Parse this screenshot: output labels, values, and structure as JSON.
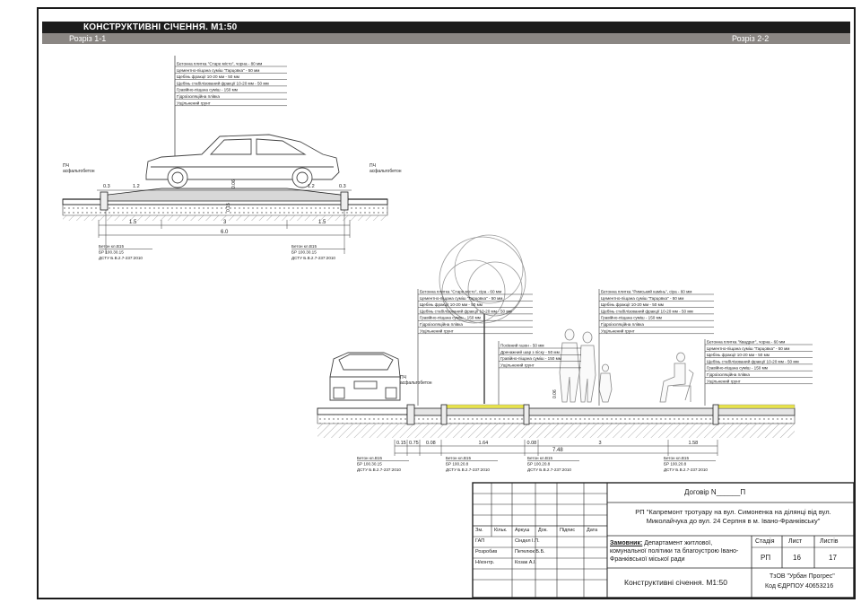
{
  "title": "КОНСТРУКТИВНІ СІЧЕННЯ. М1:50",
  "section1": {
    "label": "Розріз 1-1",
    "layers": [
      "Бетонна плитка \"Старе місто\", чорна - 80 мм",
      "Цементно-піщана суміш \"Гарцовка\" - 50 мм",
      "Щебінь фракції 10-20 мм - 50 мм",
      "Щебінь стабілізований фракції 10-20 мм - 50 мм",
      "Гравійно-піщана суміш - 150 мм",
      "Гідроізоляційна плівка",
      "Ущільнений грунт"
    ],
    "asphalt_left": "ПЧ\nасфальтобетон",
    "asphalt_right": "ПЧ\nасфальтобетон",
    "dims_top": [
      "0.3",
      "1.2",
      "1.2",
      "0.3"
    ],
    "dims_bottom": [
      "1.5",
      "3",
      "1.5"
    ],
    "dim_total": "6.0",
    "vertical_dims": [
      "0.06",
      "0.15"
    ],
    "curb_left": [
      "Бетон кл.В15",
      "БР 100.30.15",
      "ДСТУ Б.В.2.7-237:2010"
    ],
    "curb_right": [
      "Бетон кл.В15",
      "БР 100.30.15",
      "ДСТУ Б.В.2.7-237:2010"
    ]
  },
  "section2": {
    "label": "Розріз 2-2",
    "layers_a": [
      "Бетонна плитка \"Старе місто\", сіра - 60 мм",
      "Цементно-піщана суміш \"Гарцовка\" - 50 мм",
      "Щебінь фракції 10-20 мм - 50 мм",
      "Щебінь стабілізований фракції 10-20 мм - 50 мм",
      "Гравійно-піщана суміш - 150 мм",
      "Гідроізоляційна плівка",
      "Ущільнений грунт"
    ],
    "layers_b": [
      "Бетонна плитка \"Римський камінь\", сіра - 60 мм",
      "Цементно-піщана суміш \"Гарцовка\" - 50 мм",
      "Щебінь фракції 10-20 мм - 50 мм",
      "Щебінь стабілізований фракції 10-20 мм - 50 мм",
      "Гравійно-піщана суміш - 150 мм",
      "Гідроізоляційна плівка",
      "Ущільнений грунт"
    ],
    "layers_c": [
      "Бетонна плитка \"Квадрат\", чорна - 60 мм",
      "Цементно-піщана суміш \"Гарцовка\" - 50 мм",
      "Щебінь фракції 10-20 мм - 50 мм",
      "Щебінь стабілізований фракції 10-20 мм - 50 мм",
      "Гравійно-піщана суміш - 150 мм",
      "Гідроізоляційна плівка",
      "Ущільнений грунт"
    ],
    "layers_d": [
      "Посівний газон - 50 мм",
      "Дренажний шар з піску - 50 мм",
      "Гравійно-піщана суміш - 150 мм",
      "Ущільнений грунт"
    ],
    "asphalt": "ПЧ\nасфальтобетон",
    "dims": [
      "0.15",
      "0.75",
      "0.08",
      "1.64",
      "0.08",
      "3",
      "1.58"
    ],
    "dim_total": "7.48",
    "vertical_dims": [
      "0.06"
    ],
    "curbs": [
      [
        "Бетон кл.В15",
        "БР 100.30.15",
        "ДСТУ Б.В.2.7-237:2010"
      ],
      [
        "Бетон кл.В15",
        "БР 100.20.8",
        "ДСТУ Б.В.2.7-237:2010"
      ],
      [
        "Бетон кл.В15",
        "БР 100.20.8",
        "ДСТУ Б.В.2.7-237:2010"
      ],
      [
        "Бетон кл.В15",
        "БР 100.20.8",
        "ДСТУ Б.В.2.7-237:2010"
      ]
    ]
  },
  "title_block": {
    "contract": "Договір N______П",
    "project": "РП \"Капремонт тротуару на вул. Симоненка на ділянці від вул. Миколайчука до вул. 24 Серпня в м. Івано-Франківську\"",
    "headers": [
      "Зм.",
      "Кільк.",
      "Аркуш",
      "Док.",
      "Підпис",
      "Дата"
    ],
    "roles": [
      {
        "role": "ГАП",
        "name": "Сіндел І.П."
      },
      {
        "role": "Розробив",
        "name": "Петелюк Б.Б."
      },
      {
        "role": "Н/контр.",
        "name": "Козак А.І."
      }
    ],
    "customer_label": "Замовник:",
    "customer": "Департамент житлової, комунальної політики та благоустрою Івано-Франківської міської ради",
    "stage_label": "Стадія",
    "sheet_label": "Лист",
    "sheets_label": "Листів",
    "stage": "РП",
    "sheet": "16",
    "sheets": "17",
    "drawing_title": "Конструктивні січення. М1:50",
    "company": "ТзОВ \"Урбан Прогрес\"",
    "company_code": "Код ЄДРПОУ 40653216"
  }
}
